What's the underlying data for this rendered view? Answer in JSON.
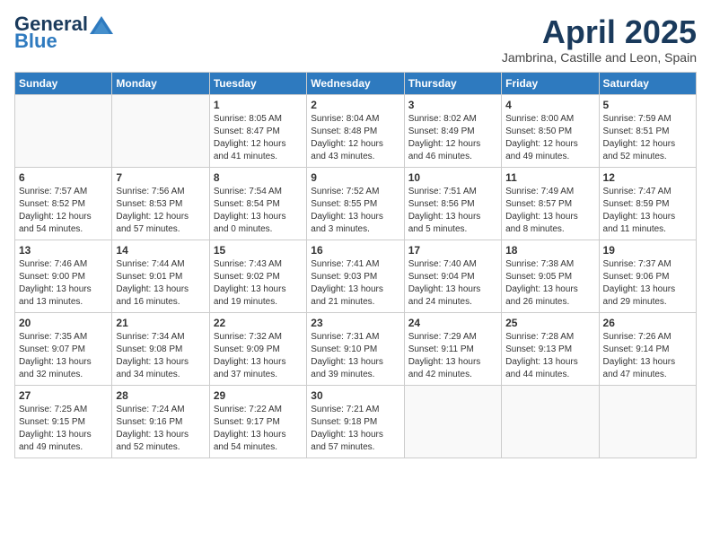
{
  "header": {
    "logo_general": "General",
    "logo_blue": "Blue",
    "month_title": "April 2025",
    "subtitle": "Jambrina, Castille and Leon, Spain"
  },
  "weekdays": [
    "Sunday",
    "Monday",
    "Tuesday",
    "Wednesday",
    "Thursday",
    "Friday",
    "Saturday"
  ],
  "weeks": [
    [
      {
        "day": "",
        "info": ""
      },
      {
        "day": "",
        "info": ""
      },
      {
        "day": "1",
        "info": "Sunrise: 8:05 AM\nSunset: 8:47 PM\nDaylight: 12 hours and 41 minutes."
      },
      {
        "day": "2",
        "info": "Sunrise: 8:04 AM\nSunset: 8:48 PM\nDaylight: 12 hours and 43 minutes."
      },
      {
        "day": "3",
        "info": "Sunrise: 8:02 AM\nSunset: 8:49 PM\nDaylight: 12 hours and 46 minutes."
      },
      {
        "day": "4",
        "info": "Sunrise: 8:00 AM\nSunset: 8:50 PM\nDaylight: 12 hours and 49 minutes."
      },
      {
        "day": "5",
        "info": "Sunrise: 7:59 AM\nSunset: 8:51 PM\nDaylight: 12 hours and 52 minutes."
      }
    ],
    [
      {
        "day": "6",
        "info": "Sunrise: 7:57 AM\nSunset: 8:52 PM\nDaylight: 12 hours and 54 minutes."
      },
      {
        "day": "7",
        "info": "Sunrise: 7:56 AM\nSunset: 8:53 PM\nDaylight: 12 hours and 57 minutes."
      },
      {
        "day": "8",
        "info": "Sunrise: 7:54 AM\nSunset: 8:54 PM\nDaylight: 13 hours and 0 minutes."
      },
      {
        "day": "9",
        "info": "Sunrise: 7:52 AM\nSunset: 8:55 PM\nDaylight: 13 hours and 3 minutes."
      },
      {
        "day": "10",
        "info": "Sunrise: 7:51 AM\nSunset: 8:56 PM\nDaylight: 13 hours and 5 minutes."
      },
      {
        "day": "11",
        "info": "Sunrise: 7:49 AM\nSunset: 8:57 PM\nDaylight: 13 hours and 8 minutes."
      },
      {
        "day": "12",
        "info": "Sunrise: 7:47 AM\nSunset: 8:59 PM\nDaylight: 13 hours and 11 minutes."
      }
    ],
    [
      {
        "day": "13",
        "info": "Sunrise: 7:46 AM\nSunset: 9:00 PM\nDaylight: 13 hours and 13 minutes."
      },
      {
        "day": "14",
        "info": "Sunrise: 7:44 AM\nSunset: 9:01 PM\nDaylight: 13 hours and 16 minutes."
      },
      {
        "day": "15",
        "info": "Sunrise: 7:43 AM\nSunset: 9:02 PM\nDaylight: 13 hours and 19 minutes."
      },
      {
        "day": "16",
        "info": "Sunrise: 7:41 AM\nSunset: 9:03 PM\nDaylight: 13 hours and 21 minutes."
      },
      {
        "day": "17",
        "info": "Sunrise: 7:40 AM\nSunset: 9:04 PM\nDaylight: 13 hours and 24 minutes."
      },
      {
        "day": "18",
        "info": "Sunrise: 7:38 AM\nSunset: 9:05 PM\nDaylight: 13 hours and 26 minutes."
      },
      {
        "day": "19",
        "info": "Sunrise: 7:37 AM\nSunset: 9:06 PM\nDaylight: 13 hours and 29 minutes."
      }
    ],
    [
      {
        "day": "20",
        "info": "Sunrise: 7:35 AM\nSunset: 9:07 PM\nDaylight: 13 hours and 32 minutes."
      },
      {
        "day": "21",
        "info": "Sunrise: 7:34 AM\nSunset: 9:08 PM\nDaylight: 13 hours and 34 minutes."
      },
      {
        "day": "22",
        "info": "Sunrise: 7:32 AM\nSunset: 9:09 PM\nDaylight: 13 hours and 37 minutes."
      },
      {
        "day": "23",
        "info": "Sunrise: 7:31 AM\nSunset: 9:10 PM\nDaylight: 13 hours and 39 minutes."
      },
      {
        "day": "24",
        "info": "Sunrise: 7:29 AM\nSunset: 9:11 PM\nDaylight: 13 hours and 42 minutes."
      },
      {
        "day": "25",
        "info": "Sunrise: 7:28 AM\nSunset: 9:13 PM\nDaylight: 13 hours and 44 minutes."
      },
      {
        "day": "26",
        "info": "Sunrise: 7:26 AM\nSunset: 9:14 PM\nDaylight: 13 hours and 47 minutes."
      }
    ],
    [
      {
        "day": "27",
        "info": "Sunrise: 7:25 AM\nSunset: 9:15 PM\nDaylight: 13 hours and 49 minutes."
      },
      {
        "day": "28",
        "info": "Sunrise: 7:24 AM\nSunset: 9:16 PM\nDaylight: 13 hours and 52 minutes."
      },
      {
        "day": "29",
        "info": "Sunrise: 7:22 AM\nSunset: 9:17 PM\nDaylight: 13 hours and 54 minutes."
      },
      {
        "day": "30",
        "info": "Sunrise: 7:21 AM\nSunset: 9:18 PM\nDaylight: 13 hours and 57 minutes."
      },
      {
        "day": "",
        "info": ""
      },
      {
        "day": "",
        "info": ""
      },
      {
        "day": "",
        "info": ""
      }
    ]
  ]
}
